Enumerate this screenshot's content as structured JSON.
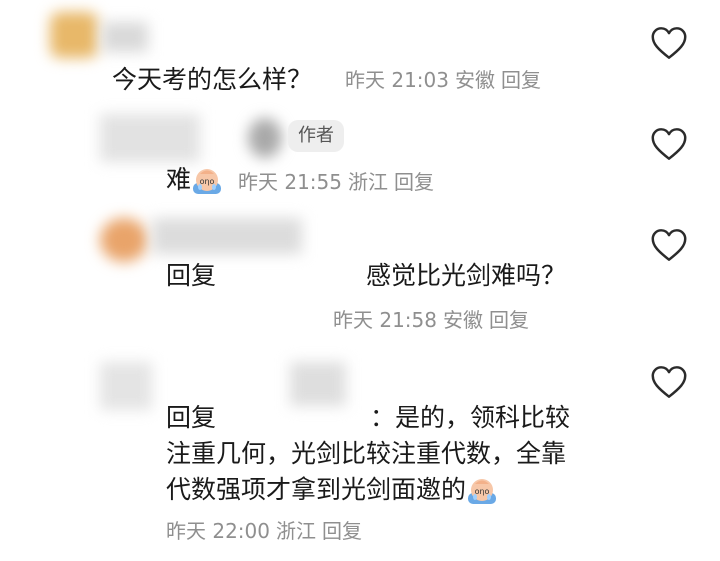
{
  "comments": [
    {
      "text": "今天考的怎么样？",
      "time": "昨天 21:03",
      "location": "安徽",
      "reply_label": "回复"
    },
    {
      "author_tag": "作者",
      "text": "难",
      "time": "昨天 21:55",
      "location": "浙江",
      "reply_label": "回复"
    },
    {
      "reply_prefix": "回复",
      "text": "感觉比光剑难吗？",
      "time": "昨天 21:58",
      "location": "安徽",
      "reply_label": "回复"
    },
    {
      "reply_prefix": "回复",
      "text_line1": "：是的，领科比较",
      "text_line2": "注重几何，光剑比较注重代数，全靠",
      "text_line3": "代数强项才拿到光剑面邀的",
      "time": "昨天 22:00",
      "location": "浙江",
      "reply_label": "回复"
    }
  ],
  "icons": {
    "like": "heart-outline-icon",
    "emoji": "crying-emoji-icon"
  },
  "colors": {
    "text": "#1a1a1a",
    "meta": "#8f8f8f",
    "tag_bg": "#eeeeee"
  }
}
